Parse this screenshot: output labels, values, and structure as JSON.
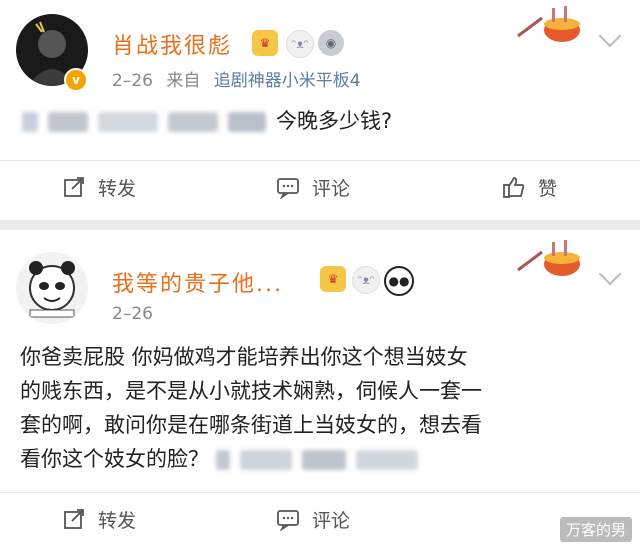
{
  "posts": [
    {
      "username": "肖战我很彪",
      "date": "2–26",
      "source_prefix": "来自",
      "source": "追剧神器小米平板4",
      "text": "今晚多少钱?",
      "badges": [
        "crown-medal-icon",
        "bunny-mask-icon",
        "silver-medal-icon"
      ],
      "actions": {
        "repost": "转发",
        "comment": "评论",
        "like": "赞"
      }
    },
    {
      "username": "我等的贵子他...",
      "date": "2–26",
      "text_lines": [
        "你爸卖屁股 你妈做鸡才能培养出你这个想当妓女",
        "的贱东西，是不是从小就技术娴熟，伺候人一套一",
        "套的啊，敢问你是在哪条街道上当妓女的，想去看",
        "看你这个妓女的脸？"
      ],
      "badges": [
        "crown-medal-icon",
        "bunny-mask-icon",
        "panda-icon"
      ],
      "actions": {
        "repost": "转发",
        "comment": "评论"
      }
    }
  ],
  "watermark": "万客的男",
  "colors": {
    "username": "#e8701a",
    "source": "#5b7ea4",
    "badge": "#f4a400"
  }
}
